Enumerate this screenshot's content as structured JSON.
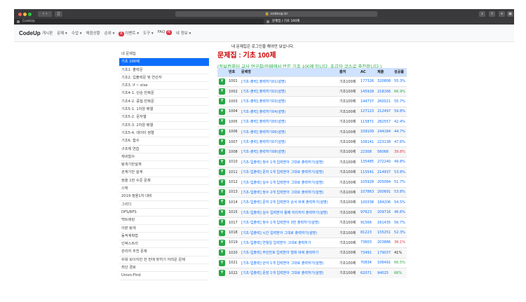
{
  "browser": {
    "address": "codeup.kr",
    "tabs": [
      {
        "label": "CodeUp"
      },
      {
        "label": "문제집 / 기초 100제"
      }
    ]
  },
  "navbar": {
    "brand": "CodeUp",
    "items": [
      "게시판",
      "문제 ▾",
      "수업 ▾",
      "채점상황",
      "순위 ▾",
      "이벤트 ▾",
      "도구 ▾",
      "FAQ",
      "내 정보 ▾"
    ],
    "event_badge": "8",
    "faq_badge": "N"
  },
  "notice": "내 문제집은 로그인을 해야만 보입니다.",
  "sidebar": {
    "items": [
      "내 문제집",
      "기초 100제",
      "기초1. 출력문",
      "기초2. 입출력문 및 연산자",
      "기초3. if ~ else",
      "기초4-1. 단순 반복문",
      "기초4-2. 중첩 반복문",
      "기초5-1. 1차원 배열",
      "기초5-2. 문자열",
      "기초5-3. 2차원 배열",
      "기초5-4. 데이터 정렬",
      "기초6. 함수",
      "구조체 연습",
      "재귀함수",
      "탐색기반설계",
      "관계기반 설계",
      "정올 1번 수준 문제",
      "스택",
      "2019 정올1차 대비",
      "그리디",
      "DFS/BFS",
      "백트래킹",
      "이분 탐색",
      "동적계획법",
      "인덱스트리",
      "관리자 추천 문제",
      "쉬워 보이지만 한 번에 맞히기 어려운 문제",
      "최단 경로",
      "Union-Find"
    ],
    "active_index": 1
  },
  "content": {
    "title": "문제집 : 기초 100제",
    "subtitle": "(정보컴퓨터 교사 연구회/카페에서 만든 기초 100제 입니다. 초급자 코스로 추천합니다.)"
  },
  "table": {
    "headers": [
      "",
      "번호",
      "문제명",
      "출처",
      "AC",
      "제출",
      "성공률"
    ],
    "badge": "Y",
    "rows": [
      [
        "1001",
        "[기초-출력] 출력하기01(설명)",
        "기초100제",
        "177326",
        "320808",
        "55.3%",
        "blue"
      ],
      [
        "1002",
        "[기초-출력] 출력하기02(설명)",
        "기초100제",
        "145928",
        "218166",
        "66.9%",
        "green"
      ],
      [
        "1003",
        "[기초-출력] 출력하기03(설명)",
        "기초100제",
        "144737",
        "260021",
        "55.7%",
        "blue"
      ],
      [
        "1004",
        "[기초-출력] 출력하기04(설명)",
        "기초100제",
        "127123",
        "212497",
        "59.8%",
        "blue"
      ],
      [
        "1005",
        "[기초-출력] 출력하기05(설명)",
        "기초100제",
        "115871",
        "282557",
        "42.4%",
        "blue"
      ],
      [
        "1006",
        "[기초-출력] 출력하기06(설명)",
        "기초100제",
        "109109",
        "244184",
        "44.7%",
        "blue"
      ],
      [
        "1007",
        "[기초-출력] 출력하기07(설명)",
        "기초100제",
        "106141",
        "223138",
        "47.6%",
        "blue"
      ],
      [
        "1008",
        "[기초-출력] 출력하기08(설명)",
        "기초100제",
        "22308",
        "56068",
        "39.8%",
        "red"
      ],
      [
        "1010",
        "[기초-입출력] 정수 1개 입력받아 그대로 출력하기(설명)",
        "기초100제",
        "135485",
        "272240",
        "49.8%",
        "blue"
      ],
      [
        "1011",
        "[기초-입출력] 문자 1개 입력받아 그대로 출력하기(설명)",
        "기초100제",
        "115541",
        "214937",
        "53.8%",
        "blue"
      ],
      [
        "1012",
        "[기초-입출력] 실수 1개 입력받아 그대로 출력하기(설명)",
        "기초100제",
        "105928",
        "205084",
        "51.7%",
        "blue"
      ],
      [
        "1013",
        "[기초-입출력] 정수 2개 입력받아 그대로 출력하기(설명)",
        "기초100제",
        "107863",
        "200691",
        "53.8%",
        "blue"
      ],
      [
        "1014",
        "[기초-입출력] 문자 2개 입력받아 순서 바꿔 출력하기(설명)",
        "기초100제",
        "100338",
        "184206",
        "54.5%",
        "blue"
      ],
      [
        "1015",
        "[기초-입출력] 실수 입력받아 둘째 자리까지 출력하기(설명)",
        "기초100제",
        "97623",
        "209716",
        "46.6%",
        "blue"
      ],
      [
        "1017",
        "[기초-입출력] 정수 1개 입력받아 3번 출력하기(설명)",
        "기초100제",
        "91566",
        "161435",
        "56.7%",
        "blue"
      ],
      [
        "1018",
        "[기초-입출력] 시간 입력받아 그대로 출력하기(설명)",
        "기초100제",
        "81223",
        "155251",
        "52.3%",
        "blue"
      ],
      [
        "1019",
        "[기초-입출력] 연월일 입력받아 그대로 출력하기",
        "기초100제",
        "73603",
        "203886",
        "36.1%",
        "red"
      ],
      [
        "1020",
        "[기초-입출력] 주민번호 입력받아 형태 바꿔 출력하기",
        "기초100제",
        "73491",
        "179037",
        "41%",
        "plain"
      ],
      [
        "1021",
        "[기초-입출력] 단어 1개 입력받아 그대로 출력하기(설명)",
        "기초100제",
        "70834",
        "106491",
        "66.5%",
        "green"
      ],
      [
        "1022",
        "[기초-입출력] 문장 1개 입력받아 그대로 출력하기(설명)",
        "기초100제",
        "62071",
        "94025",
        "66%",
        "green"
      ]
    ]
  },
  "colors": {
    "accent": "#0d6efd",
    "title_red": "#cc0000",
    "subtitle_green": "#28a745",
    "badge_green": "#28a745",
    "table_header": "#cfe2ff"
  }
}
